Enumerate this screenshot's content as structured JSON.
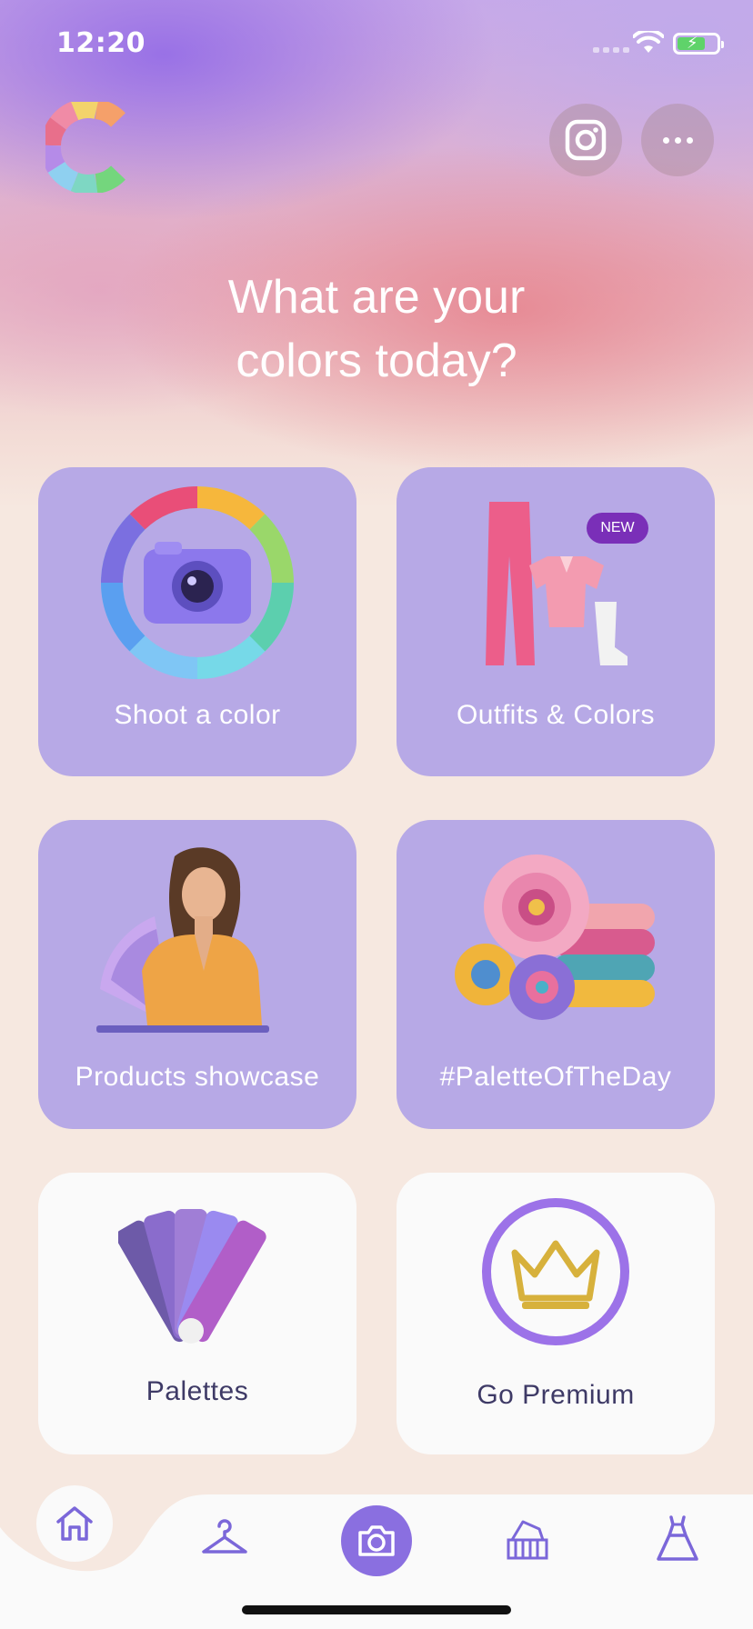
{
  "status_bar": {
    "time": "12:20"
  },
  "headline": {
    "line1": "What are your",
    "line2": "colors today?"
  },
  "cards": [
    {
      "label": "Shoot a color"
    },
    {
      "label": "Outfits & Colors",
      "badge": "NEW"
    },
    {
      "label": "Products showcase"
    },
    {
      "label": "#PaletteOfTheDay"
    },
    {
      "label": "Palettes"
    },
    {
      "label": "Go Premium"
    }
  ],
  "tab_bar": {
    "tabs": [
      "home-icon",
      "hanger-icon",
      "camera-icon",
      "palette-fan-icon",
      "dress-icon"
    ],
    "accent": "#8a6fe0"
  },
  "colors": {
    "card_purple": "#b7a9e6",
    "badge_purple": "#7a2fb8",
    "text_dark": "#3e3a66"
  }
}
